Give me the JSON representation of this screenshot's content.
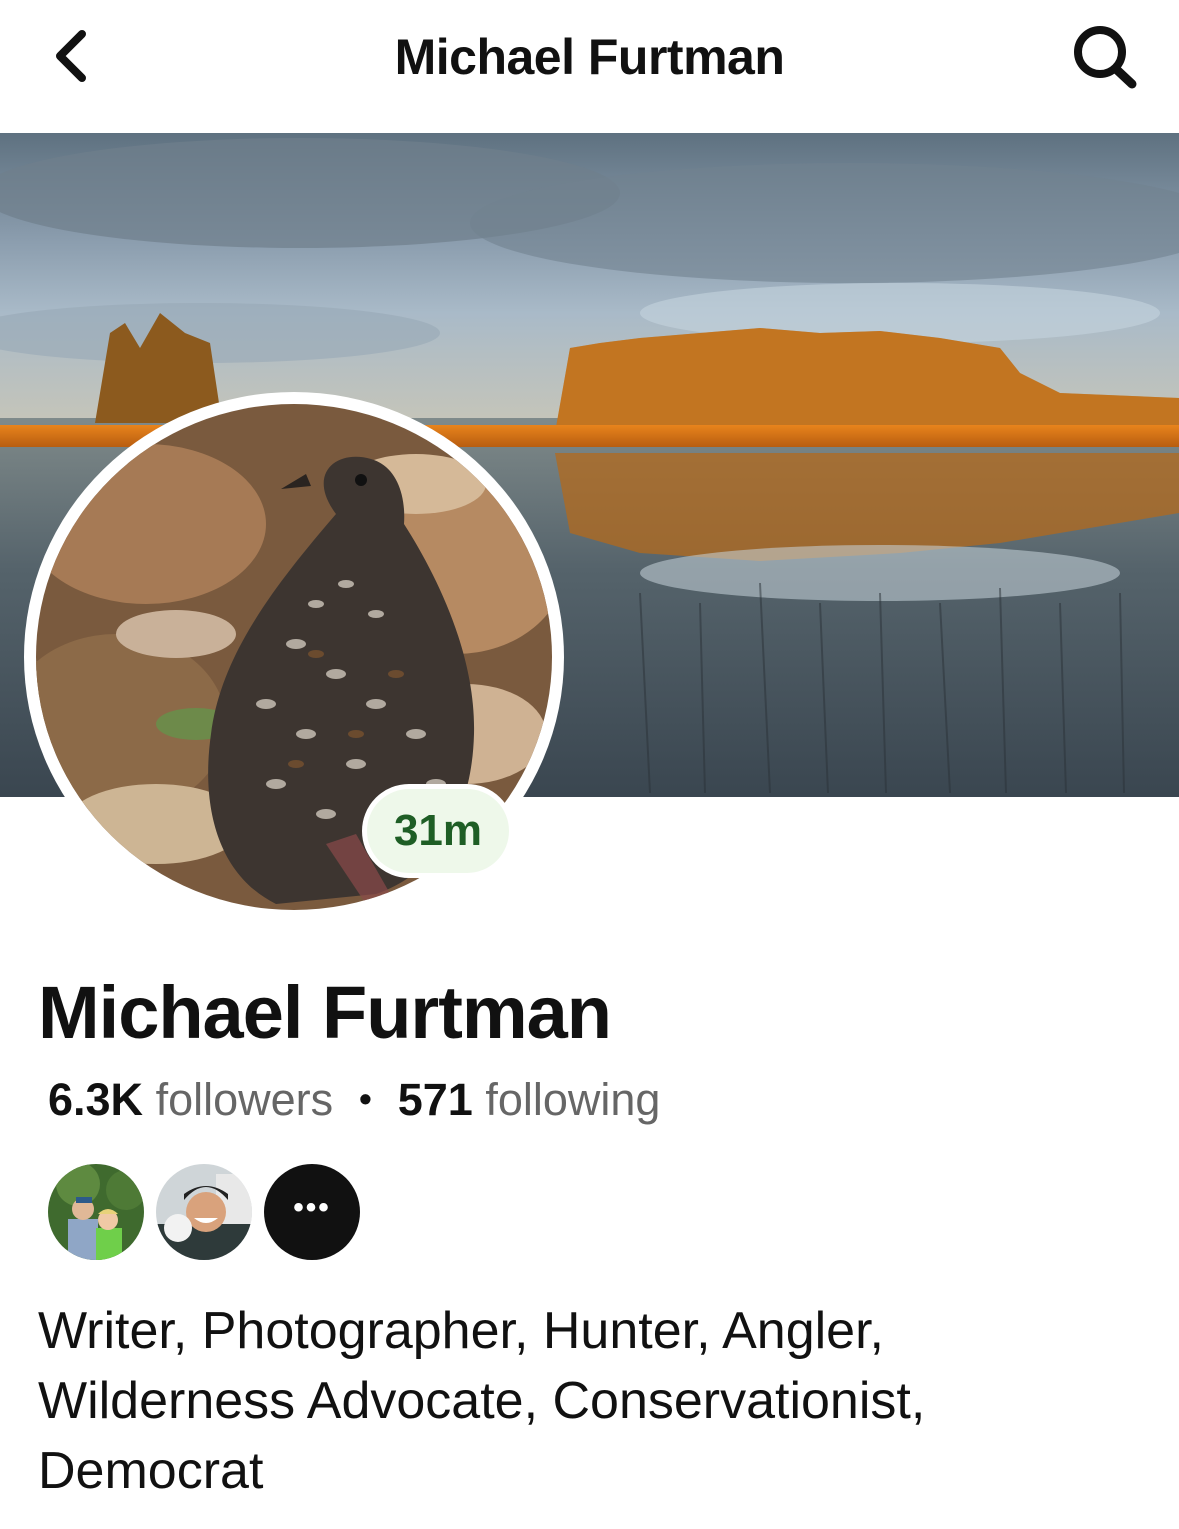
{
  "header": {
    "title": "Michael Furtman",
    "back_icon": "chevron-left-icon",
    "search_icon": "search-icon"
  },
  "cover": {
    "description_icon": "cover-photo"
  },
  "avatar": {
    "status_label": "31m"
  },
  "profile": {
    "name": "Michael Furtman",
    "followers_count": "6.3K",
    "followers_label": "followers",
    "separator": "•",
    "following_count": "571",
    "following_label": "following"
  },
  "mutual_friends": {
    "more_label": "•••"
  },
  "bio": {
    "lines": [
      "Writer, Photographer, Hunter, Angler,",
      "Wilderness Advocate, Conservationist,",
      "Democrat"
    ]
  },
  "colors": {
    "status_green": "#1e5e25",
    "status_bg": "#eef8ea",
    "muted_text": "#666666"
  }
}
